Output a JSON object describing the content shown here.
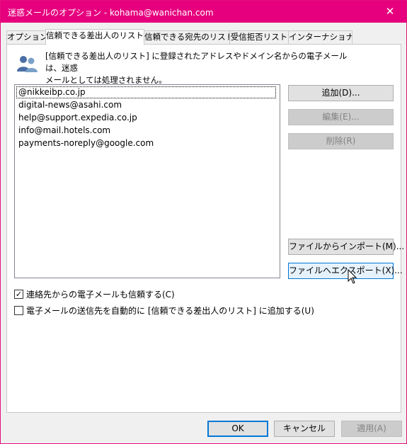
{
  "window": {
    "title": "迷惑メールのオプション - kohama@wanichan.com",
    "close_glyph": "✕",
    "accent_color": "#e6007e"
  },
  "tabs": [
    {
      "label": "オプション",
      "active": false
    },
    {
      "label": "信頼できる差出人のリスト",
      "active": true
    },
    {
      "label": "信頼できる宛先のリスト",
      "active": false
    },
    {
      "label": "受信拒否リスト",
      "active": false
    },
    {
      "label": "インターナショナル",
      "active": false
    }
  ],
  "info": {
    "icon": "people-icon",
    "line1": "[信頼できる差出人のリスト] に登録されたアドレスやドメイン名からの電子メールは、迷惑",
    "line2": "メールとしては処理されません。"
  },
  "list": {
    "items": [
      "@nikkeibp.co.jp",
      "digital-news@asahi.com",
      "help@support.expedia.co.jp",
      "info@mail.hotels.com",
      "payments-noreply@google.com"
    ]
  },
  "buttons": {
    "add": "追加(D)...",
    "edit": "編集(E)...",
    "delete": "削除(R)",
    "import": "ファイルからインポート(M)...",
    "export": "ファイルへエクスポート(X)..."
  },
  "checkboxes": [
    {
      "label": "連絡先からの電子メールも信頼する(C)",
      "checked": true
    },
    {
      "label": "電子メールの送信先を自動的に [信頼できる差出人のリスト] に追加する(U)",
      "checked": false
    }
  ],
  "footer": {
    "ok": "OK",
    "cancel": "キャンセル",
    "apply": "適用(A)"
  }
}
